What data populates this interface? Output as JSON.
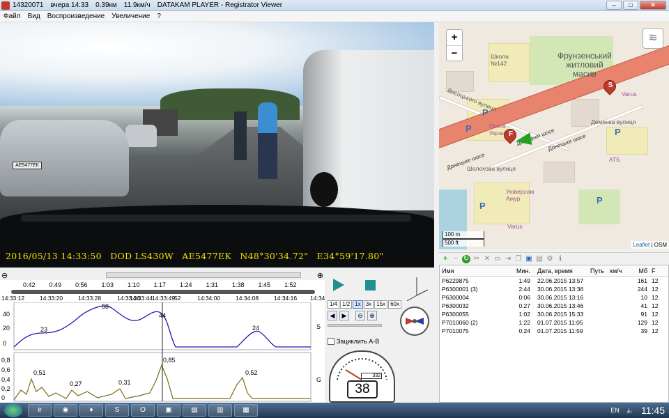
{
  "titlebar": {
    "segments": [
      "14320071",
      "вчера 14:33",
      "0.39км",
      "11.9км/ч",
      "DATAKAM PLAYER - Registrator Viewer"
    ],
    "btn_min": "–",
    "btn_max": "□",
    "btn_close": "✕"
  },
  "menu": [
    "Файл",
    "Вид",
    "Воспроизведение",
    "Увеличение",
    "?"
  ],
  "video": {
    "plate": "АЕ5477ЕК",
    "osd": [
      "2016/05/13 14:33:50",
      "DOD LS430W",
      "AE5477EK",
      "N48°30'34.72\"",
      "E34°59'17.80\""
    ]
  },
  "map": {
    "zoom_in": "+",
    "zoom_out": "−",
    "layers_icon": "≋",
    "labels": {
      "district": "Фрунзенський\nжитловий\nмасив",
      "school": "Школа\n№142",
      "highway1": "Донецьке шосе",
      "highway2": "Донецьке шосе",
      "highway3": "Донецьке шосе",
      "demchenko": "Деменка вулиця",
      "sholokhov": "Шолохова вулиця",
      "vysotsky": "Висоцького вулиця",
      "varus1": "Varus",
      "varus2": "Varus",
      "atb": "АТБ",
      "univ": "Універсам\nАмур",
      "pochta": "Почта\nУкраина"
    },
    "pin_start": "S",
    "pin_finish": "F",
    "park": "P",
    "scale_m": "100 m",
    "scale_ft": "500 ft",
    "attrib_leaflet": "Leaflet",
    "attrib_osm": "OSM"
  },
  "filelist": {
    "headers": [
      "Имя",
      "Мин.",
      "Дата, время",
      "Путь",
      "км/ч",
      "Мб",
      "F"
    ],
    "rows": [
      [
        "P6229875",
        "1:49",
        "22.06.2015 13:57",
        "",
        "",
        "161",
        "12"
      ],
      [
        "P6300001 (3)",
        "2:44",
        "30.06.2015 13:36",
        "",
        "",
        "244",
        "12"
      ],
      [
        "P6300004",
        "0:06",
        "30.06.2015 13:16",
        "",
        "",
        "10",
        "12"
      ],
      [
        "P6300032",
        "0:27",
        "30.06.2015 13:46",
        "",
        "",
        "41",
        "12"
      ],
      [
        "P6300055",
        "1:02",
        "30.06.2015 15:33",
        "",
        "",
        "91",
        "12"
      ],
      [
        "P7010060 (2)",
        "1:22",
        "01.07.2015 11:05",
        "",
        "",
        "129",
        "12"
      ],
      [
        "P7010075",
        "0:24",
        "01.07.2015 11:59",
        "",
        "",
        "39",
        "12"
      ]
    ]
  },
  "timeline": {
    "zoom_out": "⊖",
    "zoom_in": "⊕",
    "ticks": [
      "0:42",
      "0:49",
      "0:56",
      "1:03",
      "1:10",
      "1:17",
      "1:24",
      "1:31",
      "1:38",
      "1:45",
      "1:52"
    ],
    "times": [
      "14:33:12",
      "14:33:20",
      "14:33:28",
      "14:33:36",
      "14:33:44",
      "14:33:49",
      "52",
      "14:34:00",
      "14:34:08",
      "14:34:16",
      "14:34:24"
    ]
  },
  "graph": {
    "speed_axis": [
      "40",
      "20",
      "0"
    ],
    "g_axis": [
      "0,8",
      "0,6",
      "0,4",
      "0,2",
      "0"
    ],
    "speed_label": "S",
    "g_label": "G",
    "speed_peaks": [
      "23",
      "58",
      "44",
      "24"
    ],
    "g_peaks": [
      "0,51",
      "0,27",
      "0,31",
      "0,85",
      "0,52"
    ]
  },
  "controls": {
    "speeds": [
      "1/4",
      "1/2",
      "1x",
      "3x",
      "15x",
      "60x"
    ],
    "prev": "◀",
    "next": "▶",
    "zoom_minus": "⊖",
    "zoom_plus": "⊕",
    "loop_label": "Зациклить A-B",
    "axes": "y  z\n x",
    "gauge_value": "38",
    "odometer": "332"
  },
  "taskbar": {
    "apps": [
      "e",
      "◉",
      "♦",
      "S",
      "O",
      "▣",
      "▤",
      "▥",
      "▦"
    ],
    "lang": "EN",
    "clock": "11:45"
  }
}
